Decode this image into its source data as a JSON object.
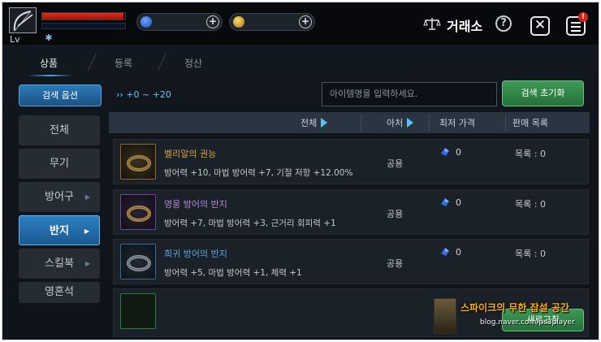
{
  "hud": {
    "level_label": "Lv",
    "hp_fraction": 0.98,
    "mp_fraction": 0.0,
    "currencies": [
      {
        "icon": "blue-gem-icon",
        "color": "#2f6fe0"
      },
      {
        "icon": "gold-coin-icon",
        "color": "#d8a22a"
      }
    ],
    "plus_label": "+"
  },
  "header": {
    "title": "거래소",
    "help_label": "?",
    "close_label": "✕",
    "badge_label": "!"
  },
  "tabs": [
    "상품",
    "등록",
    "정산"
  ],
  "sidebar": {
    "search_options_label": "검색 옵션",
    "categories": [
      {
        "label": "전체",
        "has_arrow": false,
        "active": false
      },
      {
        "label": "무기",
        "has_arrow": false,
        "active": false
      },
      {
        "label": "방어구",
        "has_arrow": true,
        "active": false
      },
      {
        "label": "반지",
        "has_arrow": true,
        "active": true
      },
      {
        "label": "스킬북",
        "has_arrow": true,
        "active": false
      },
      {
        "label": "영혼석",
        "has_arrow": false,
        "active": false
      }
    ]
  },
  "filter": {
    "range_label": "›› +0 ~ +20",
    "search_placeholder": "아이템명을 입력하세요.",
    "reset_label": "검색 초기화"
  },
  "table": {
    "headers": {
      "all": "전체",
      "class": "아처",
      "lowest_price": "최저 가격",
      "listings": "판매 목록"
    },
    "rows": [
      {
        "name": "벨리알의 권능",
        "name_color": "#d6a440",
        "stats": "방어력 +10, 마법 방어력 +7, 기절 저항 +12.00%",
        "class": "공용",
        "price": "0",
        "listing": "목록 : 0",
        "grade": "gold"
      },
      {
        "name": "영웅 방어의 반지",
        "name_color": "#b68ad8",
        "stats": "방어력 +7, 마법 방어력 +3, 근거리 회피력 +1",
        "class": "공용",
        "price": "0",
        "listing": "목록 : 0",
        "grade": "purple"
      },
      {
        "name": "희귀 방어의 반지",
        "name_color": "#5fa8e0",
        "stats": "방어력 +5, 마법 방어력 +1, 체력 +1",
        "class": "공용",
        "price": "0",
        "listing": "목록 : 0",
        "grade": "blue"
      }
    ]
  },
  "watermark": {
    "title": "스파이크의 무한 잡설 공간",
    "url": "blog.naver.com/ps3player",
    "button_label": "새로고침"
  }
}
